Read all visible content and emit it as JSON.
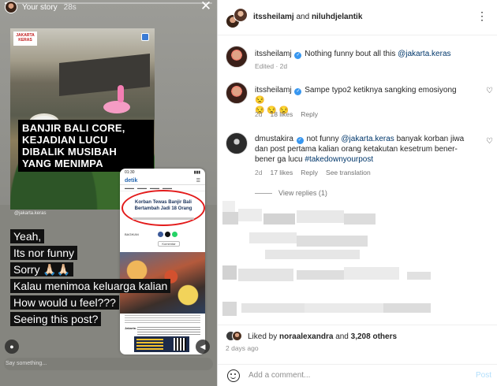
{
  "story": {
    "username": "Your story",
    "time": "28s",
    "progress": 0.03,
    "post": {
      "brand_line1": "JAKARTA",
      "brand_line2": "KERAS",
      "headline": [
        "BANJIR BALI CORE,",
        "KEJADIAN LUCU",
        "DIBALIK MUSIBAH",
        "YANG MENIMPA"
      ],
      "credit": "@jakarta.keras"
    },
    "phone": {
      "time": "01:30",
      "site": "detik",
      "article_title": "Korban Tewas Banjir Bali Bertambah Jadi 18 Orang",
      "share_label": "BAGIKAN",
      "comment_label": "Komentar",
      "body_lead": "Jakarta -"
    },
    "overlay_lines": [
      "Yeah,",
      "Its nor funny",
      "Sorry 🙏🏻🙏🏻",
      "Kalau menimoa keluarga kalian",
      "How would u feel???",
      "Seeing this post?"
    ],
    "say_placeholder": "Say something..."
  },
  "post": {
    "header": {
      "user1": "itssheilamj",
      "connector": "and",
      "user2": "niluhdjelantik"
    },
    "caption": {
      "user": "itssheilamj",
      "text": "Nothing funny bout all this",
      "mention": "@jakarta.keras",
      "meta": "Edited · 2d"
    },
    "comments": [
      {
        "user": "itssheilamj",
        "text": "Sampe typo2 ketiknya sangking emosiyong 😒",
        "text2": "😒 😒 😒",
        "age": "2d",
        "likes": "18 likes",
        "reply": "Reply"
      },
      {
        "user": "dmustakira",
        "text_pre": "not funny",
        "mention": "@jakarta.keras",
        "text_post": "banyak korban jiwa dan post pertama kalian orang ketakutan kesetrum bener-bener ga lucu",
        "hashtag": "#takedownyourpost",
        "age": "2d",
        "likes": "17 likes",
        "reply": "Reply",
        "translate": "See translation"
      }
    ],
    "view_replies": "View replies (1)",
    "liked_prefix": "Liked by",
    "liked_user": "noraalexandra",
    "liked_and": "and",
    "liked_count": "3,208 others",
    "ago": "2 days ago",
    "add_comment_placeholder": "Add a comment...",
    "post_label": "Post"
  },
  "colors": {
    "mention": "#00376b",
    "verified": "#3897f0",
    "post_button_disabled": "#b2dffc",
    "headline_bg": "#000000",
    "oval": "#e31b1b"
  }
}
